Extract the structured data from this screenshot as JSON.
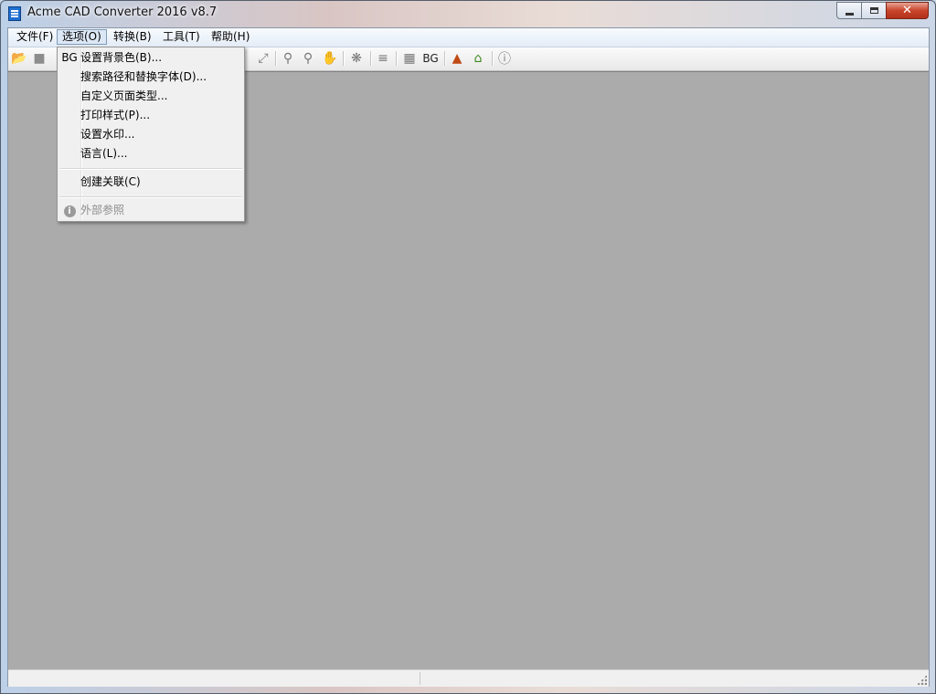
{
  "window": {
    "title": "Acme CAD Converter 2016 v8.7",
    "close_glyph": "✕"
  },
  "menubar": {
    "items": [
      "文件(F)",
      "选项(O)",
      "转换(B)",
      "工具(T)",
      "帮助(H)"
    ],
    "active_index": 1
  },
  "toolbar": {
    "icons": [
      "folder-open-icon",
      "save-icon",
      "zoom-window-icon",
      "zoom-in-icon",
      "zoom-out-icon",
      "pan-icon",
      "layers-icon",
      "pages-icon",
      "background-color-icon",
      "batch-convert-icon",
      "home-icon",
      "about-icon"
    ],
    "bg_label": "BG"
  },
  "options_menu": {
    "items": [
      {
        "icon_text": "BG",
        "label": "设置背景色(B)...",
        "enabled": true
      },
      {
        "icon_text": "",
        "label": "搜索路径和替换字体(D)...",
        "enabled": true
      },
      {
        "icon_text": "",
        "label": "自定义页面类型...",
        "enabled": true
      },
      {
        "icon_text": "",
        "label": "打印样式(P)...",
        "enabled": true
      },
      {
        "icon_text": "",
        "label": "设置水印...",
        "enabled": true
      },
      {
        "icon_text": "",
        "label": "语言(L)...",
        "enabled": true
      },
      {
        "icon_text": "",
        "label": "创建关联(C)",
        "enabled": true
      },
      {
        "icon_text": "i",
        "label": "外部参照",
        "enabled": false
      }
    ]
  },
  "colors": {
    "workspace": "#ababab",
    "menu_bg": "#f0f0f0",
    "disabled_text": "#8d8d8d"
  }
}
